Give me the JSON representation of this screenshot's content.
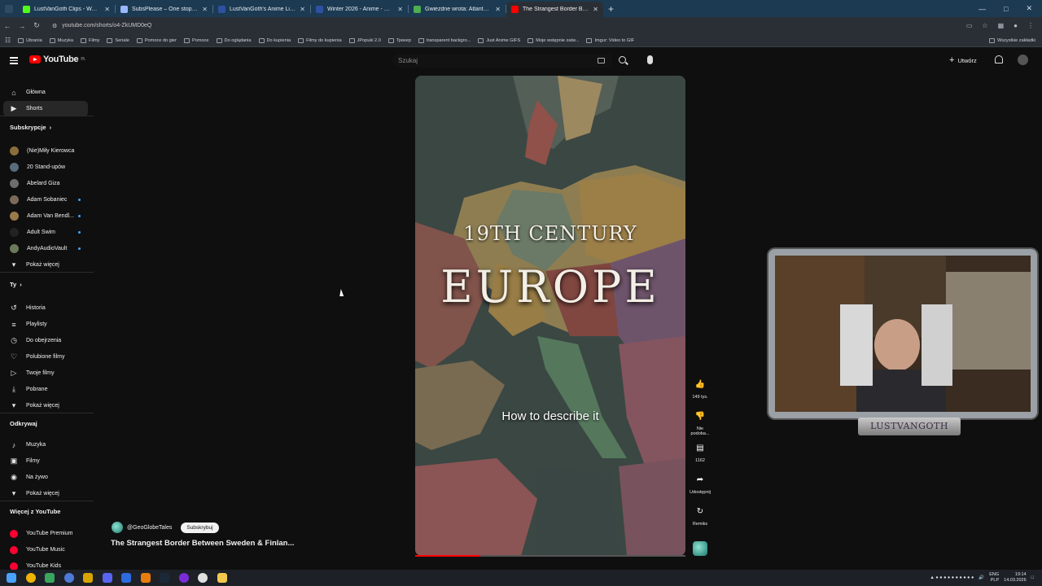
{
  "browser": {
    "tabs": [
      {
        "title": "LustVanGoth Clips - Watch Live",
        "color": "#53fc18",
        "active": false
      },
      {
        "title": "SubsPlease – One stop shop fo",
        "color": "#9ab8ff",
        "active": false
      },
      {
        "title": "LustVanGoth's Anime List - My",
        "color": "#2e51a2",
        "active": false
      },
      {
        "title": "Winter 2026 - Anime - MyAnim",
        "color": "#2e51a2",
        "active": false
      },
      {
        "title": "Gwiezdne wrota: Atlantyda / St",
        "color": "#4caf50",
        "active": false
      },
      {
        "title": "The Strangest Border Betwe",
        "color": "#ff0000",
        "active": true
      }
    ],
    "url": "youtube.com/shorts/o4-ZkUMD0eQ",
    "bookmarks": [
      "Ubrania",
      "Muzyka",
      "Filmy",
      "Seriale",
      "Pomoce do gier",
      "Pomoce",
      "Do oglądania",
      "Do kupienia",
      "Filmy do kupienia",
      "JPopuki 2.0",
      "Трекер",
      "transparent backgro...",
      "Just Anime GIFS",
      "Moje wstępnie zatw...",
      "Imgur: Video to GIF"
    ],
    "bookmarks_right": "Wszystkie zakładki"
  },
  "youtube": {
    "logo": "YouTube",
    "logo_country": "PL",
    "search_placeholder": "Szukaj",
    "create_label": "Utwórz"
  },
  "sidebar": {
    "main": [
      {
        "label": "Główna",
        "icon": "home-icon"
      },
      {
        "label": "Shorts",
        "icon": "shorts-icon",
        "active": true
      }
    ],
    "subs_title": "Subskrypcje",
    "subs": [
      {
        "label": "(Nie)Miły Kierowca",
        "color": "#8a6d3b",
        "dot": false
      },
      {
        "label": "20 Stand-upów",
        "color": "#5a6b7c",
        "dot": false
      },
      {
        "label": "Abelard Giza",
        "color": "#6d6d6d",
        "dot": false
      },
      {
        "label": "Adam Sobaniec",
        "color": "#7a6a5a",
        "dot": true
      },
      {
        "label": "Adam Van Bendl...",
        "color": "#9a7a4a",
        "dot": true
      },
      {
        "label": "Adult Swim",
        "color": "#222222",
        "dot": true
      },
      {
        "label": "AndyAudioVault",
        "color": "#6a7a5a",
        "dot": true
      }
    ],
    "show_more": "Pokaż więcej",
    "you_title": "Ty",
    "you": [
      {
        "label": "Historia",
        "icon": "history-icon"
      },
      {
        "label": "Playlisty",
        "icon": "playlist-icon"
      },
      {
        "label": "Do obejrzenia",
        "icon": "watch-later-icon"
      },
      {
        "label": "Polubione filmy",
        "icon": "like-icon"
      },
      {
        "label": "Twoje filmy",
        "icon": "your-videos-icon"
      },
      {
        "label": "Pobrane",
        "icon": "download-icon"
      }
    ],
    "explore_title": "Odkrywaj",
    "explore": [
      {
        "label": "Muzyka",
        "icon": "music-icon"
      },
      {
        "label": "Filmy",
        "icon": "movies-icon"
      },
      {
        "label": "Na żywo",
        "icon": "live-icon"
      }
    ],
    "more_title": "Więcej z YouTube",
    "more": [
      {
        "label": "YouTube Premium"
      },
      {
        "label": "YouTube Music"
      },
      {
        "label": "YouTube Kids"
      }
    ]
  },
  "short": {
    "title_line1": "19TH CENTURY",
    "title_line2": "EUROPE",
    "caption": "How to describe it",
    "channel": "@GeoGlobeTales",
    "subscribe_label": "Subskrybuj",
    "video_title": "The Strangest Border Between Sweden & Finlan...",
    "progress": 0.24,
    "actions": {
      "like_count": "149 tys.",
      "dislike_label": "Nie podoba...",
      "comments_count": "1162",
      "share_label": "Udostępnij",
      "remix_label": "Remiks"
    }
  },
  "webcam": {
    "nameplate": "LUSTVANGOTH"
  },
  "taskbar": {
    "lang": "ENG",
    "lang2": "PLP",
    "time": "19:14",
    "date": "14.03.2026"
  }
}
